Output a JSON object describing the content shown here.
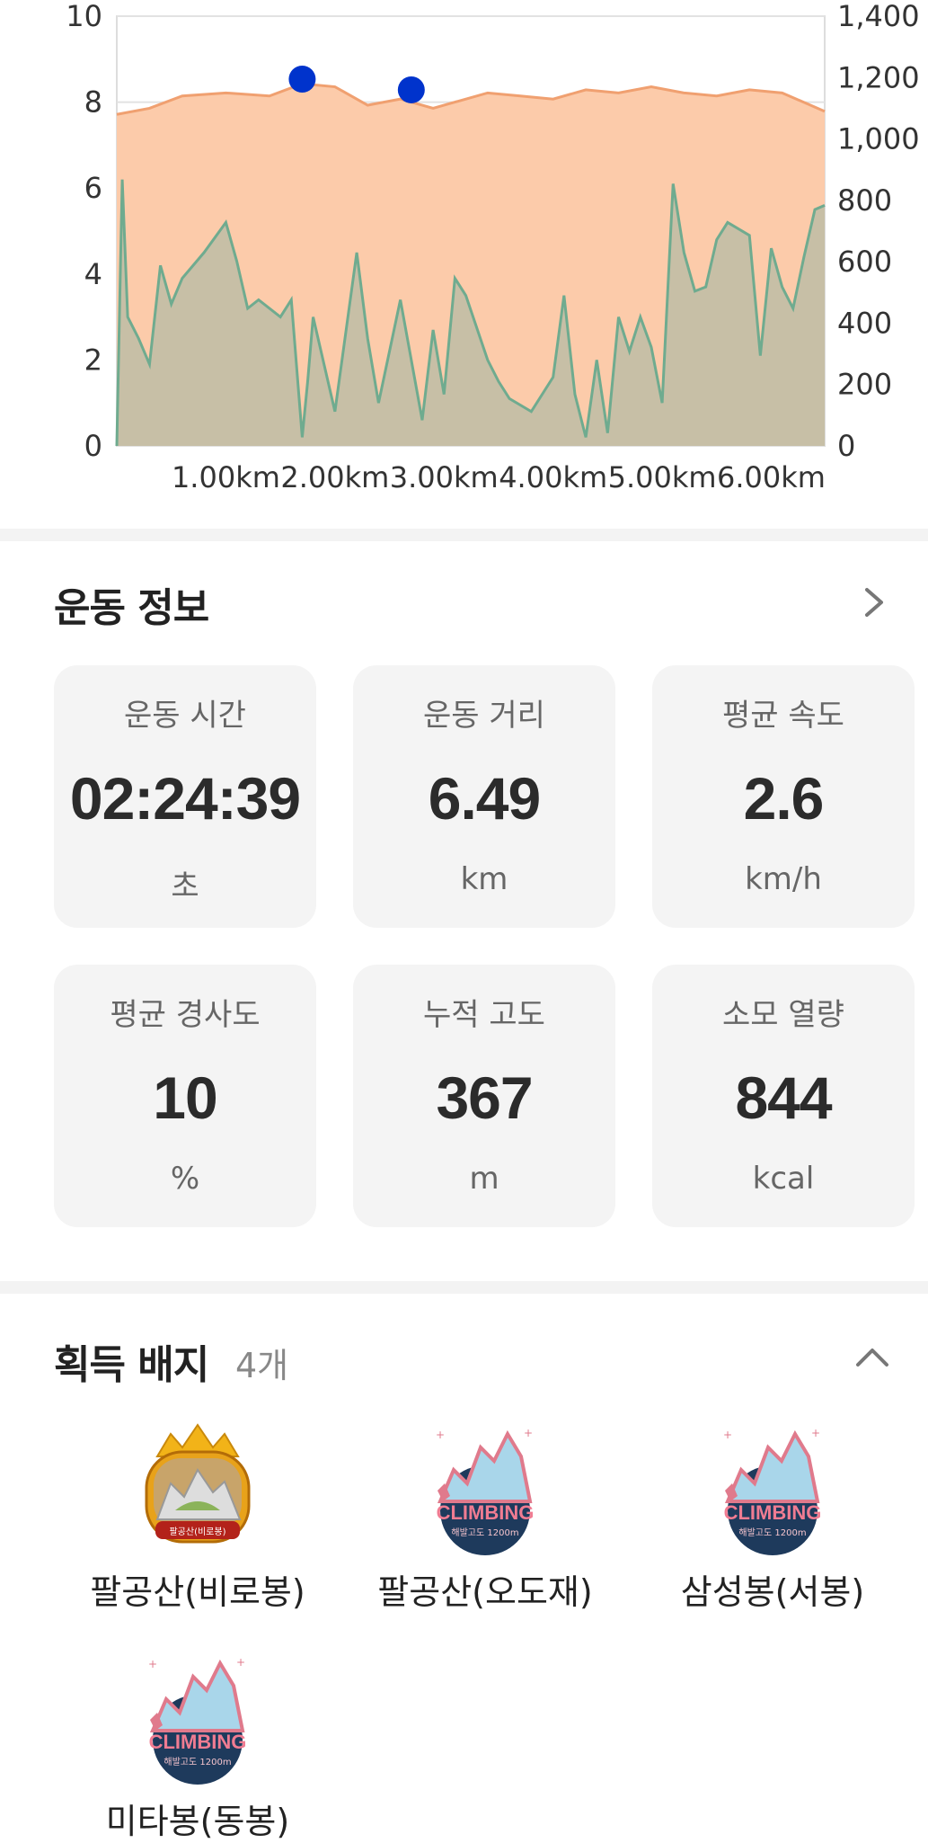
{
  "chart_data": {
    "type": "area",
    "x_unit": "km",
    "x_ticks": [
      "1.00km",
      "2.00km",
      "3.00km",
      "4.00km",
      "5.00km",
      "6.00km"
    ],
    "left_axis": {
      "ticks": [
        "0",
        "2",
        "4",
        "6",
        "8",
        "10"
      ],
      "range": [
        0,
        10
      ]
    },
    "right_axis": {
      "ticks": [
        "0",
        "200",
        "400",
        "600",
        "800",
        "1,000",
        "1,200",
        "1,400"
      ],
      "range": [
        0,
        1400
      ]
    },
    "series": [
      {
        "color": "#f0a070",
        "fill": "#fccbaa",
        "axis": "right",
        "x": [
          0,
          0.3,
          0.6,
          1.0,
          1.4,
          1.7,
          2.0,
          2.3,
          2.6,
          2.9,
          3.1,
          3.4,
          3.7,
          4.0,
          4.3,
          4.6,
          4.9,
          5.2,
          5.5,
          5.8,
          6.1,
          6.49
        ],
        "values": [
          1080,
          1100,
          1140,
          1150,
          1140,
          1180,
          1170,
          1110,
          1130,
          1100,
          1120,
          1150,
          1140,
          1130,
          1160,
          1150,
          1170,
          1150,
          1140,
          1160,
          1150,
          1090
        ]
      },
      {
        "color": "#6fab8f",
        "fill": "#bdbda6",
        "axis": "left",
        "x": [
          0,
          0.05,
          0.1,
          0.2,
          0.3,
          0.4,
          0.5,
          0.6,
          0.8,
          1.0,
          1.1,
          1.2,
          1.3,
          1.5,
          1.6,
          1.7,
          1.75,
          1.8,
          2.0,
          2.2,
          2.3,
          2.4,
          2.6,
          2.8,
          2.9,
          3.0,
          3.1,
          3.2,
          3.4,
          3.5,
          3.6,
          3.8,
          4.0,
          4.1,
          4.2,
          4.3,
          4.4,
          4.5,
          4.6,
          4.7,
          4.8,
          4.9,
          5.0,
          5.1,
          5.2,
          5.3,
          5.4,
          5.5,
          5.6,
          5.8,
          5.9,
          6.0,
          6.1,
          6.2,
          6.3,
          6.4,
          6.49
        ],
        "values": [
          0,
          6.2,
          3.0,
          2.5,
          1.9,
          4.2,
          3.3,
          3.9,
          4.5,
          5.2,
          4.3,
          3.2,
          3.4,
          3.0,
          3.4,
          0.2,
          1.5,
          3.0,
          0.8,
          4.5,
          2.5,
          1.0,
          3.4,
          0.6,
          2.7,
          1.2,
          3.9,
          3.5,
          2.0,
          1.5,
          1.1,
          0.8,
          1.6,
          3.5,
          1.2,
          0.2,
          2.0,
          0.3,
          3.0,
          2.2,
          3.0,
          2.3,
          1.0,
          6.1,
          4.5,
          3.6,
          3.7,
          4.8,
          5.2,
          4.9,
          2.1,
          4.6,
          3.7,
          3.2,
          4.4,
          5.5,
          5.6
        ]
      }
    ],
    "markers": [
      {
        "x": 1.7,
        "y": 1195,
        "color": "#0033cc"
      },
      {
        "x": 2.7,
        "y": 1160,
        "color": "#0033cc"
      }
    ],
    "grid": true
  },
  "workout": {
    "title": "운동 정보",
    "stats": [
      {
        "label": "운동 시간",
        "value": "02:24:39",
        "unit": "초"
      },
      {
        "label": "운동 거리",
        "value": "6.49",
        "unit": "km"
      },
      {
        "label": "평균 속도",
        "value": "2.6",
        "unit": "km/h"
      },
      {
        "label": "평균 경사도",
        "value": "10",
        "unit": "%"
      },
      {
        "label": "누적 고도",
        "value": "367",
        "unit": "m"
      },
      {
        "label": "소모 열량",
        "value": "844",
        "unit": "kcal"
      }
    ]
  },
  "badges": {
    "title": "획득 배지",
    "count": "4개",
    "items": [
      {
        "name": "팔공산(비로봉)",
        "icon": "gold-mountain-badge-icon",
        "badge_text": "팔공산(비로봉)"
      },
      {
        "name": "팔공산(오도재)",
        "icon": "climbing-badge-icon",
        "badge_text": "CLIMBING",
        "badge_sub": "해발고도 1200m"
      },
      {
        "name": "삼성봉(서봉)",
        "icon": "climbing-badge-icon",
        "badge_text": "CLIMBING",
        "badge_sub": "해발고도 1200m"
      },
      {
        "name": "미타봉(동봉)",
        "icon": "climbing-badge-icon",
        "badge_text": "CLIMBING",
        "badge_sub": "해발고도 1200m"
      }
    ]
  },
  "colors": {
    "accent_blue": "#0033cc",
    "card_bg": "#f4f4f4",
    "divider": "#f3f3f3"
  }
}
